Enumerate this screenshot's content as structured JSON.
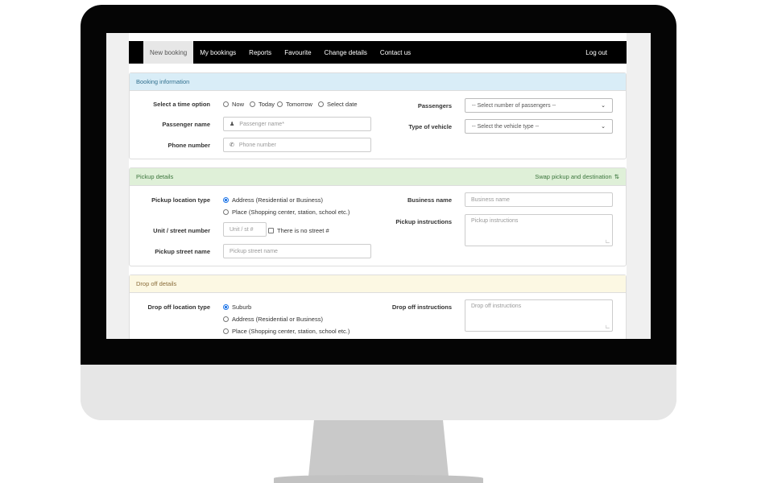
{
  "nav": {
    "items": [
      "New booking",
      "My bookings",
      "Reports",
      "Favourite",
      "Change details",
      "Contact us"
    ],
    "logout": "Log out"
  },
  "booking": {
    "heading": "Booking information",
    "time_label": "Select a time option",
    "time_options": [
      "Now",
      "Today",
      "Tomorrow",
      "Select date"
    ],
    "passenger_name_label": "Passenger name",
    "passenger_name_placeholder": "Passenger name*",
    "phone_label": "Phone number",
    "phone_placeholder": "Phone number",
    "passengers_label": "Passengers",
    "passengers_select": "-- Select number of passengers --",
    "vehicle_label": "Type of vehicle",
    "vehicle_select": "-- Select the vehicle type --"
  },
  "pickup": {
    "heading": "Pickup details",
    "swap_label": "Swap pickup and destination",
    "location_type_label": "Pickup location type",
    "location_options": [
      "Address (Residential or Business)",
      "Place (Shopping center, station, school etc.)"
    ],
    "unit_label": "Unit / street number",
    "unit_placeholder": "Unit / st #",
    "no_street_label": "There is no street #",
    "street_label": "Pickup street name",
    "street_placeholder": "Pickup street name",
    "business_label": "Business name",
    "business_placeholder": "Business name",
    "instructions_label": "Pickup instructions",
    "instructions_placeholder": "Pickup instructions"
  },
  "dropoff": {
    "heading": "Drop off details",
    "location_type_label": "Drop off location type",
    "location_options": [
      "Suburb",
      "Address (Residential or Business)",
      "Place (Shopping center, station, school etc.)"
    ],
    "instructions_label": "Drop off instructions",
    "instructions_placeholder": "Drop off instructions"
  },
  "icons": {
    "person": "person-icon",
    "phone": "phone-icon",
    "swap": "swap-icon",
    "caret": "chevron-down-icon"
  }
}
